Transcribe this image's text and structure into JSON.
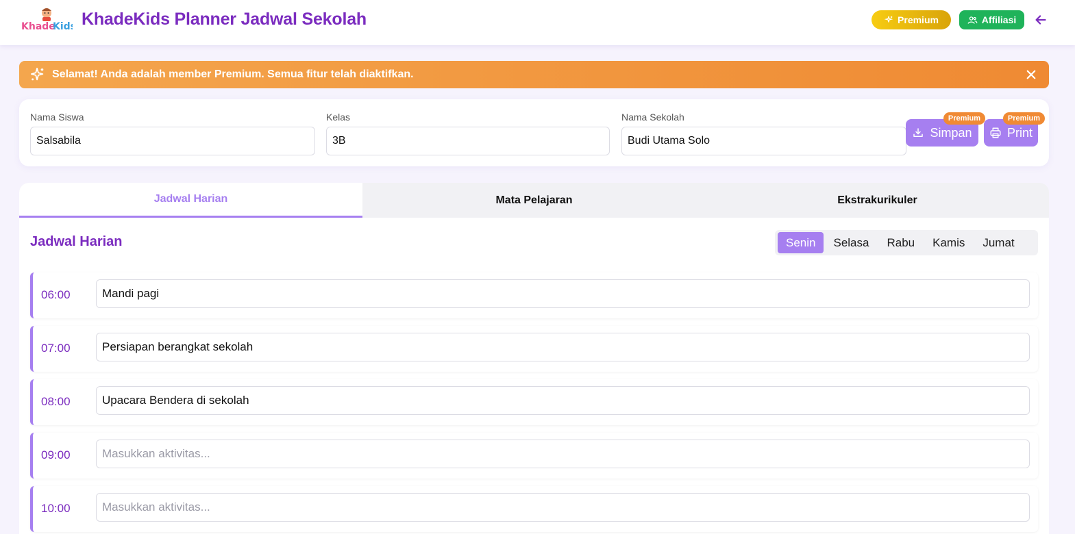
{
  "header": {
    "logo_text": "KhadeKids",
    "title": "KhadeKids Planner Jadwal Sekolah",
    "premium_label": "Premium",
    "affiliasi_label": "Affiliasi"
  },
  "banner": {
    "text": "Selamat! Anda adalah member Premium. Semua fitur telah diaktifkan."
  },
  "form": {
    "nama_siswa_label": "Nama Siswa",
    "nama_siswa_value": "Salsabila",
    "kelas_label": "Kelas",
    "kelas_value": "3B",
    "nama_sekolah_label": "Nama Sekolah",
    "nama_sekolah_value": "Budi Utama Solo",
    "simpan_label": "Simpan",
    "print_label": "Print",
    "premium_badge": "Premium"
  },
  "tabs": [
    {
      "label": "Jadwal Harian",
      "active": true
    },
    {
      "label": "Mata Pelajaran",
      "active": false
    },
    {
      "label": "Ekstrakurikuler",
      "active": false
    }
  ],
  "main": {
    "title": "Jadwal Harian",
    "days": [
      {
        "label": "Senin",
        "active": true
      },
      {
        "label": "Selasa",
        "active": false
      },
      {
        "label": "Rabu",
        "active": false
      },
      {
        "label": "Kamis",
        "active": false
      },
      {
        "label": "Jumat",
        "active": false
      }
    ],
    "placeholder": "Masukkan aktivitas...",
    "schedule": [
      {
        "time": "06:00",
        "activity": "Mandi pagi"
      },
      {
        "time": "07:00",
        "activity": "Persiapan berangkat sekolah"
      },
      {
        "time": "08:00",
        "activity": "Upacara Bendera di sekolah"
      },
      {
        "time": "09:00",
        "activity": ""
      },
      {
        "time": "10:00",
        "activity": ""
      }
    ]
  },
  "colors": {
    "brand_purple": "#7b2cbf",
    "accent_purple": "#a67ff0",
    "banner_orange": "#f08a34",
    "premium_gold": "#f7cc12",
    "affiliasi_green": "#1fb35a"
  }
}
